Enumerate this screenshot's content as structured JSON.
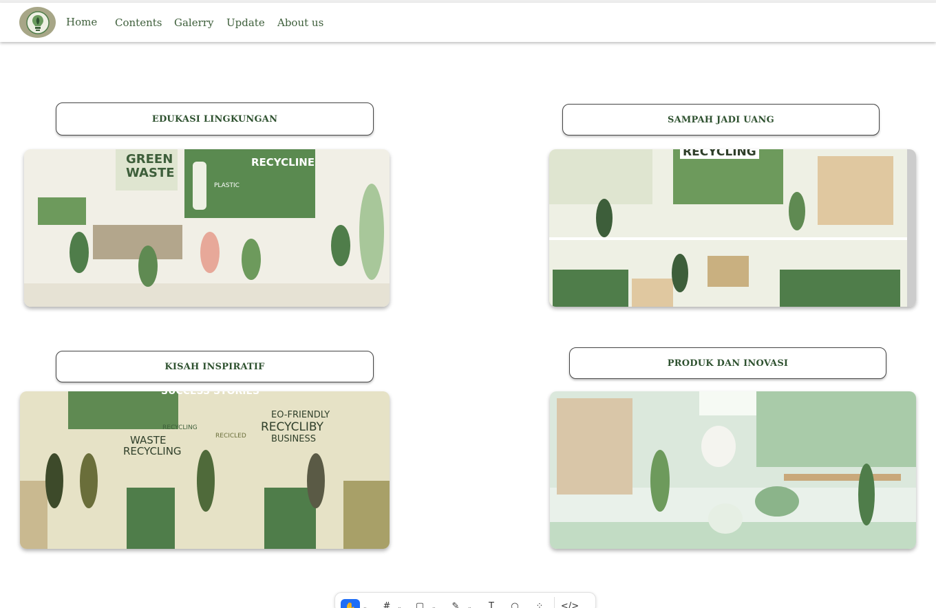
{
  "nav": {
    "logo_icon": "lightbulb-leaf-icon",
    "links": [
      "Home",
      "Contents",
      "Galerry",
      "Update",
      "About us"
    ]
  },
  "sections": [
    {
      "label": "EDUKASI LINGKUNGAN",
      "image_text": [
        "GREEN",
        "WASTE",
        "RECYCLINE",
        "PLASTIC"
      ]
    },
    {
      "label": "SAMPAH JADI UANG",
      "image_text": [
        "RECYCLING"
      ]
    },
    {
      "label": "KISAH INSPIRATIF",
      "image_text": [
        "SUCCESS STORIES",
        "RECYCLING",
        "RECICLED",
        "WASTE",
        "RECYCLING",
        "EO-FRIENDLY",
        "RECYCLIBY",
        "BUSINESS"
      ]
    },
    {
      "label": "PRODUK DAN INOVASI",
      "image_text": []
    }
  ],
  "toolbar": {
    "tools": [
      "hand-icon",
      "frame-icon",
      "rectangle-icon",
      "pen-icon",
      "text-icon",
      "comment-icon",
      "components-icon",
      "code-icon"
    ]
  },
  "colors": {
    "primary_green": "#3d5e3a",
    "heading_green": "#2f5230",
    "accent_blue": "#1e6df6"
  }
}
